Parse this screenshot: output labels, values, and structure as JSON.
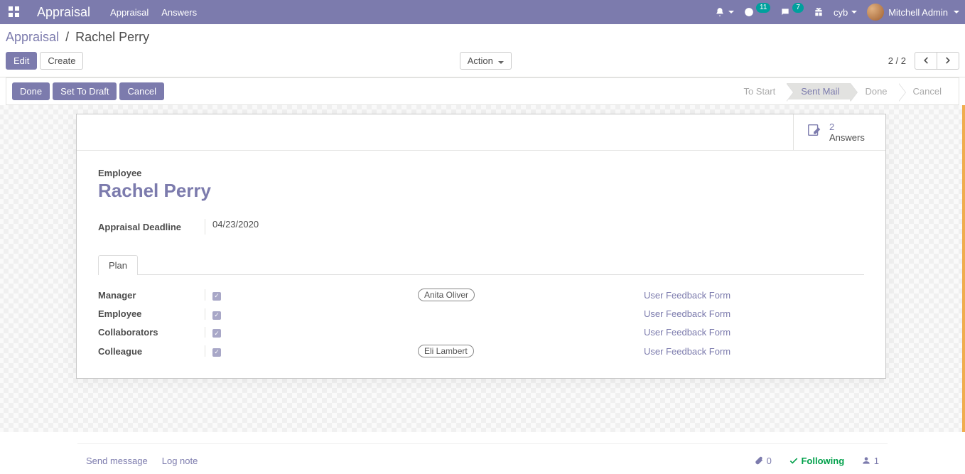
{
  "navbar": {
    "brand": "Appraisal",
    "menu": [
      "Appraisal",
      "Answers"
    ],
    "activity_count": "11",
    "msg_count": "7",
    "company": "cyb",
    "user": "Mitchell Admin"
  },
  "breadcrumb": {
    "root": "Appraisal",
    "current": "Rachel Perry"
  },
  "toolbar": {
    "edit": "Edit",
    "create": "Create",
    "action": "Action",
    "pager": "2 / 2"
  },
  "statusbar": {
    "buttons": [
      "Done",
      "Set To Draft",
      "Cancel"
    ],
    "steps": [
      "To Start",
      "Sent Mail",
      "Done",
      "Cancel"
    ],
    "active_index": 1
  },
  "stat": {
    "count": "2",
    "label": "Answers"
  },
  "form": {
    "employee_label": "Employee",
    "employee_name": "Rachel Perry",
    "deadline_label": "Appraisal Deadline",
    "deadline_value": "04/23/2020"
  },
  "tab": {
    "plan": "Plan"
  },
  "plan": {
    "rows": [
      {
        "label": "Manager",
        "checked": true,
        "tags": [
          "Anita Oliver"
        ],
        "link": "User Feedback Form"
      },
      {
        "label": "Employee",
        "checked": true,
        "tags": [],
        "link": "User Feedback Form"
      },
      {
        "label": "Collaborators",
        "checked": true,
        "tags": [],
        "link": "User Feedback Form"
      },
      {
        "label": "Colleague",
        "checked": true,
        "tags": [
          "Eli Lambert"
        ],
        "link": "User Feedback Form"
      }
    ]
  },
  "chatter": {
    "send": "Send message",
    "log": "Log note",
    "attach_count": "0",
    "following": "Following",
    "followers_count": "1"
  }
}
